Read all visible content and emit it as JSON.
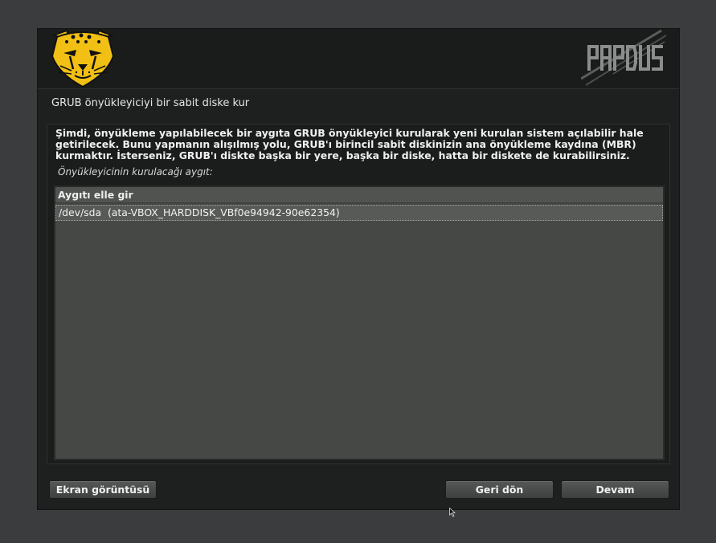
{
  "header": {
    "left_logo_icon": "cheetah-logo-icon",
    "right_logo_icon": "pardus-logo-icon"
  },
  "page": {
    "title": "GRUB önyükleyiciyi bir sabit diske kur",
    "description": "Şimdi, önyükleme yapılabilecek bir aygıta GRUB önyükleyici kurularak yeni kurulan sistem açılabilir hale\ngetirilecek. Bunu yapmanın alışılmış yolu, GRUB'ı birincil sabit diskinizin ana önyükleme kaydına (MBR)\nkurmaktır. İsterseniz, GRUB'ı diskte başka bir yere, başka bir diske, hatta bir diskete de kurabilirsiniz.",
    "device_label": "Önyükleyicinin kurulacağı aygıt:"
  },
  "device_list": {
    "items": [
      {
        "label": "Aygıtı elle gir"
      },
      {
        "label": "/dev/sda  (ata-VBOX_HARDDISK_VBf0e94942-90e62354)"
      }
    ],
    "selected_index": 1
  },
  "buttons": {
    "screenshot": "Ekran görüntüsü",
    "back": "Geri dön",
    "next": "Devam"
  },
  "colors": {
    "background": "#3b3c3e",
    "window": "#1e201f",
    "list": "#454845",
    "logo_yellow": "#f2c014"
  }
}
